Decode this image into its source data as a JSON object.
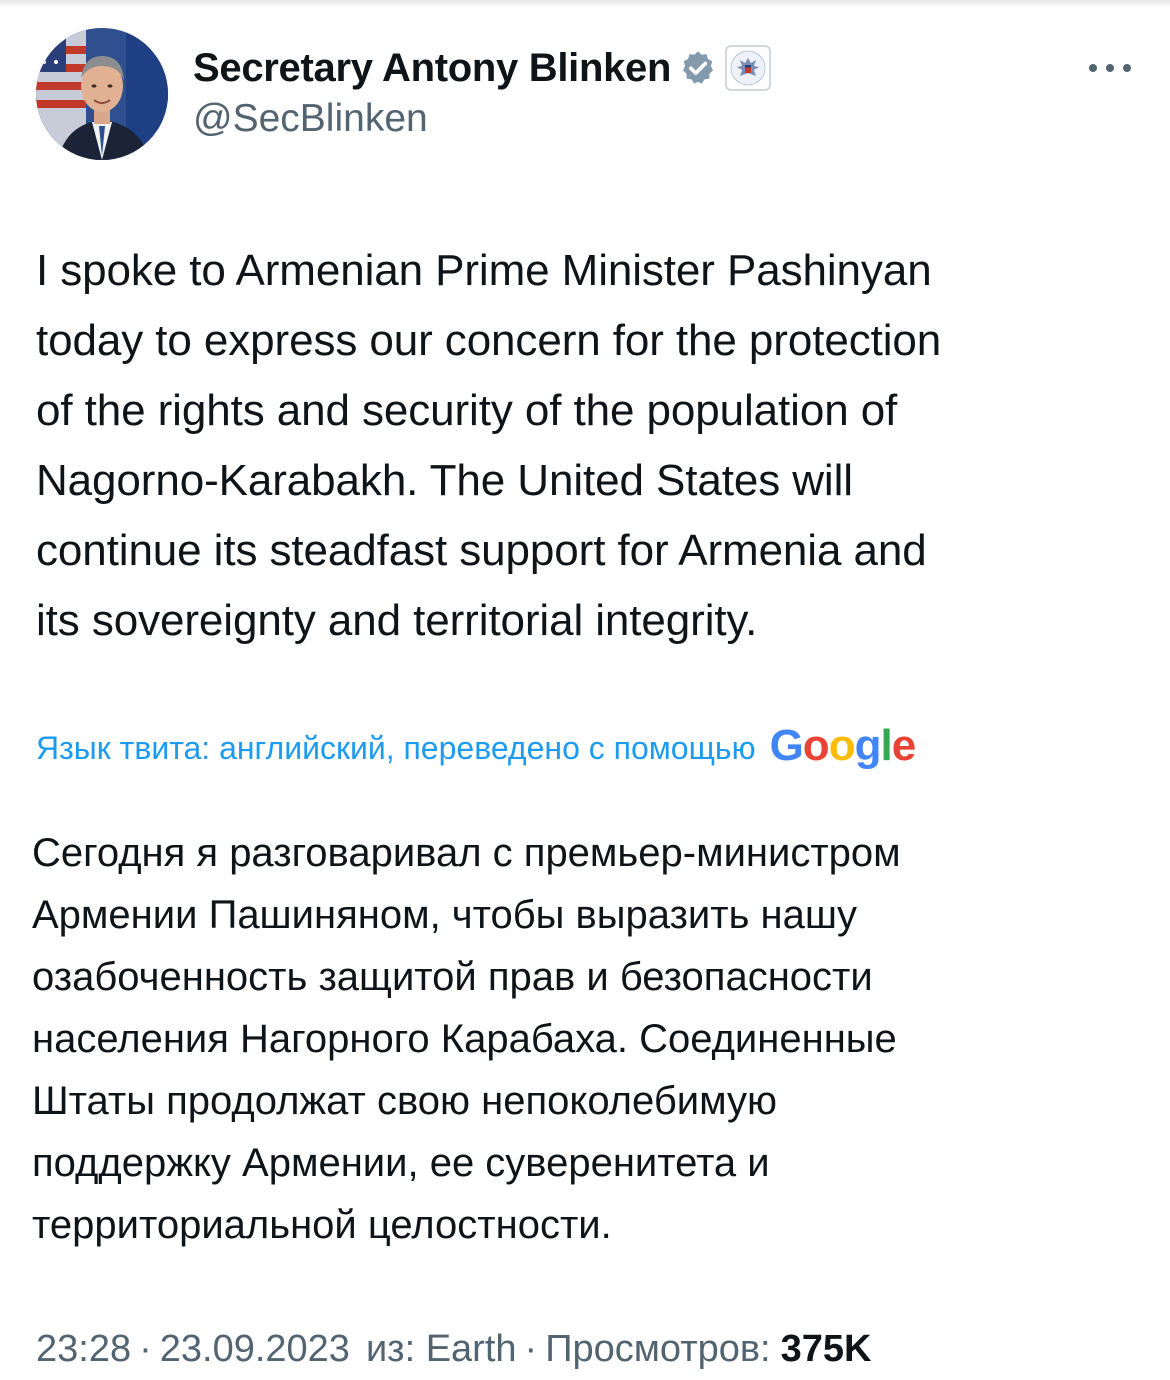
{
  "author": {
    "display_name": "Secretary Antony Blinken",
    "handle": "@SecBlinken",
    "verified_badge_icon": "verified-badge-icon",
    "affiliation_icon": "us-state-department-seal-icon"
  },
  "menu": {
    "more_icon": "more-horizontal-icon"
  },
  "tweet": {
    "text": "I spoke to Armenian Prime Minister Pashinyan\ntoday to express our concern for the protection\nof the rights and security of the population of\nNagorno-Karabakh. The United States will\ncontinue its steadfast support for Armenia and\nits sovereignty and territorial integrity."
  },
  "translation": {
    "label": "Язык твита: английский, переведено с помощью",
    "provider": "Google",
    "text": "Сегодня я разговаривал с премьер-министром\nАрмении Пашиняном, чтобы выразить нашу\nозабоченность защитой прав и безопасности\nнаселения Нагорного Карабаха. Соединенные\nШтаты продолжат свою непоколебимую\nподдержку Армении, ее суверенитета и\nтерриториальной целостности."
  },
  "meta": {
    "time": "23:28",
    "date": "23.09.2023",
    "source": "из: Earth",
    "views_label": "Просмотров:",
    "views_count": "375K"
  },
  "colors": {
    "link_blue": "#1d9bf0",
    "secondary_text": "#536471",
    "primary_text": "#0f1419",
    "verified_gray": "#829aab"
  }
}
